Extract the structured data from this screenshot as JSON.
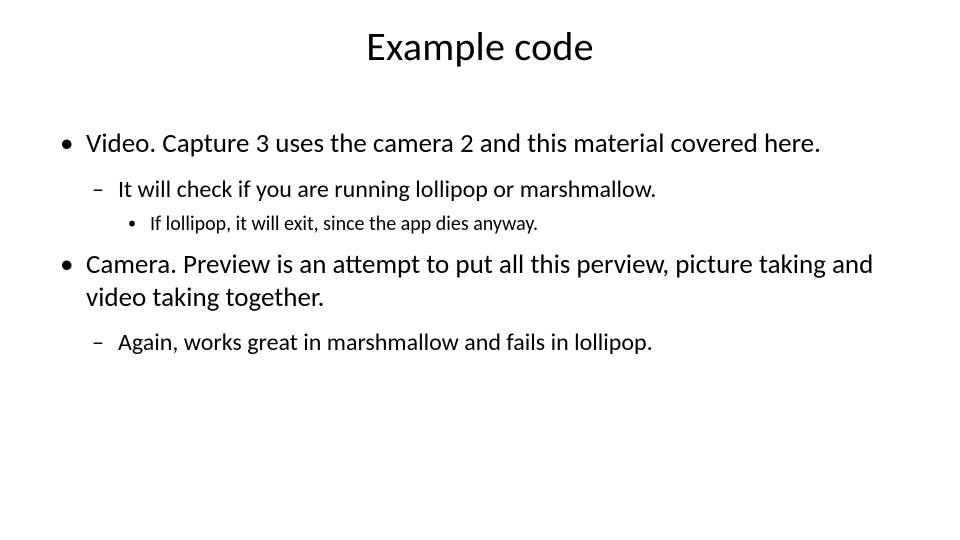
{
  "title": "Example code",
  "bullets": {
    "b1": "Video. Capture 3 uses the camera 2 and this material covered here.",
    "b1_1": "It will check if you are running lollipop or marshmallow.",
    "b1_1_1": "If lollipop, it will exit, since the app dies anyway.",
    "b2": "Camera. Preview is an attempt to put all this perview, picture taking and video taking together.",
    "b2_1": "Again, works great in marshmallow and fails in lollipop."
  }
}
